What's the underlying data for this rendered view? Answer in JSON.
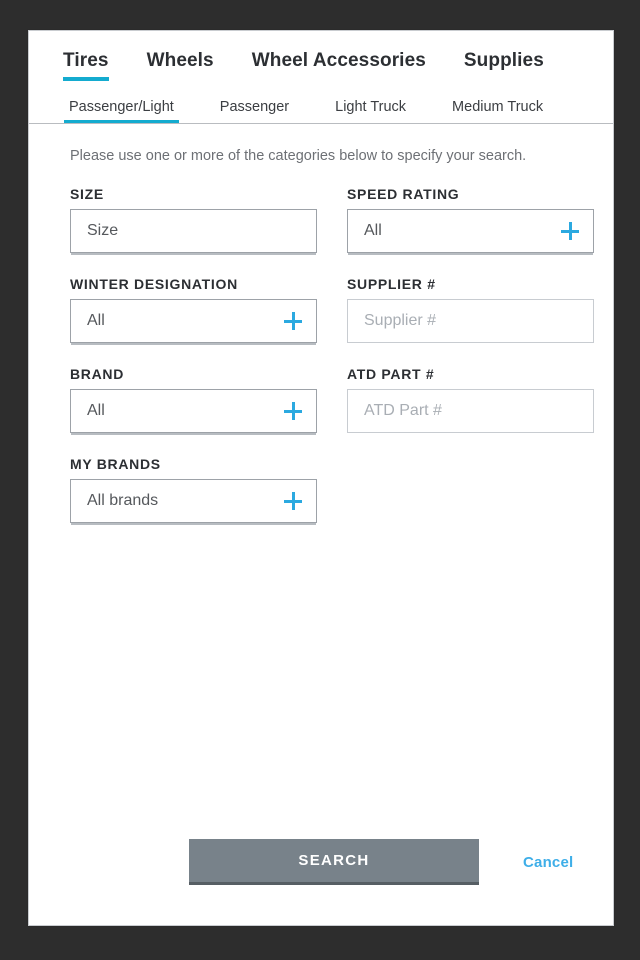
{
  "modal": {
    "instructions": "Please use one or more of the categories below to specify your search."
  },
  "tabs": {
    "primary": [
      {
        "label": "Tires",
        "active": true
      },
      {
        "label": "Wheels",
        "active": false
      },
      {
        "label": "Wheel Accessories",
        "active": false
      },
      {
        "label": "Supplies",
        "active": false
      }
    ],
    "secondary": [
      {
        "label": "Passenger/Light",
        "active": true
      },
      {
        "label": "Passenger",
        "active": false
      },
      {
        "label": "Light Truck",
        "active": false
      },
      {
        "label": "Medium Truck",
        "active": false
      }
    ]
  },
  "fields": {
    "left": [
      {
        "label": "SIZE",
        "value": "Size",
        "icon": "",
        "style": "input"
      },
      {
        "label": "WINTER DESIGNATION",
        "value": "All",
        "icon": "plus-icon",
        "style": "select"
      },
      {
        "label": "BRAND",
        "value": "All",
        "icon": "plus-icon",
        "style": "select"
      },
      {
        "label": "MY BRANDS",
        "value": "All brands",
        "icon": "plus-icon",
        "style": "select"
      }
    ],
    "right": [
      {
        "label": "SPEED RATING",
        "value": "All",
        "icon": "plus-icon",
        "style": "select"
      },
      {
        "label": "SUPPLIER #",
        "value": "Supplier #",
        "icon": "",
        "style": "placeholder"
      },
      {
        "label": "ATD PART #",
        "value": "ATD Part #",
        "icon": "",
        "style": "placeholder"
      }
    ]
  },
  "footer": {
    "search_label": "SEARCH",
    "cancel_label": "Cancel"
  },
  "colors": {
    "accent_teal": "#14ABCF",
    "plus_blue": "#2BA9E0",
    "cancel_blue": "#3EAEE8",
    "search_button": "#78828A",
    "backdrop": "#2d2d2d"
  }
}
